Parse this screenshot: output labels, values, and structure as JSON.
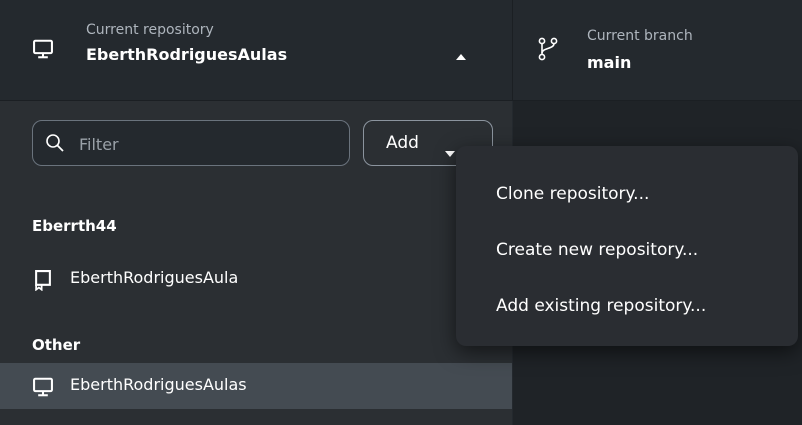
{
  "repository_header": {
    "caption": "Current repository",
    "name": "EberthRodriguesAulas"
  },
  "branch_header": {
    "caption": "Current branch",
    "name": "main"
  },
  "filter": {
    "placeholder": "Filter"
  },
  "add_button": {
    "label": "Add"
  },
  "groups": [
    {
      "title": "Eberrth44",
      "items": [
        {
          "name": "EberthRodriguesAula",
          "icon": "repo-icon"
        }
      ]
    },
    {
      "title": "Other",
      "items": [
        {
          "name": "EberthRodriguesAulas",
          "icon": "computer-icon",
          "selected": true
        }
      ]
    }
  ],
  "add_menu": [
    {
      "label": "Clone repository..."
    },
    {
      "label": "Create new repository..."
    },
    {
      "label": "Add existing repository..."
    }
  ]
}
